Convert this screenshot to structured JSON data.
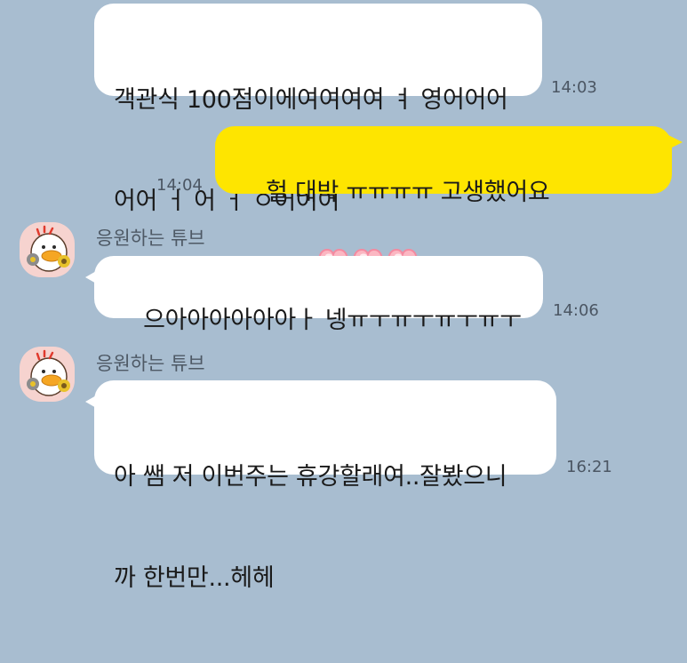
{
  "messages": [
    {
      "id": "msg1",
      "direction": "incoming",
      "lines": [
        "객관식 100점이에여여여여 ㅕ 영어어어",
        "어어 ㅓ 어 ㅓ ㅇ어어어"
      ],
      "time": "14:03"
    },
    {
      "id": "msg2",
      "direction": "outgoing",
      "text": "헐 대박 ㅠㅠㅠㅠ 고생했어요",
      "emoji": "pink-hearts-emoticon",
      "time": "14:04"
    },
    {
      "id": "msg3",
      "direction": "incoming",
      "sender": "응원하는 튜브",
      "avatar": "tube-duck-avatar",
      "text": "으아아아아아아ㅏ 넹ㅠㅜㅠㅜㅠㅜㅠㅜ",
      "time": "14:06"
    },
    {
      "id": "msg4",
      "direction": "incoming",
      "sender": "응원하는 튜브",
      "avatar": "tube-duck-avatar",
      "lines": [
        "아 쌤 저 이번주는 휴강할래여..잘봤으니",
        "까 한번만...헤헤"
      ],
      "time": "16:21"
    }
  ],
  "colors": {
    "background": "#a8bdd0",
    "incoming_bubble": "#ffffff",
    "outgoing_bubble": "#fee500",
    "avatar_bg": "#f6d3cf"
  }
}
